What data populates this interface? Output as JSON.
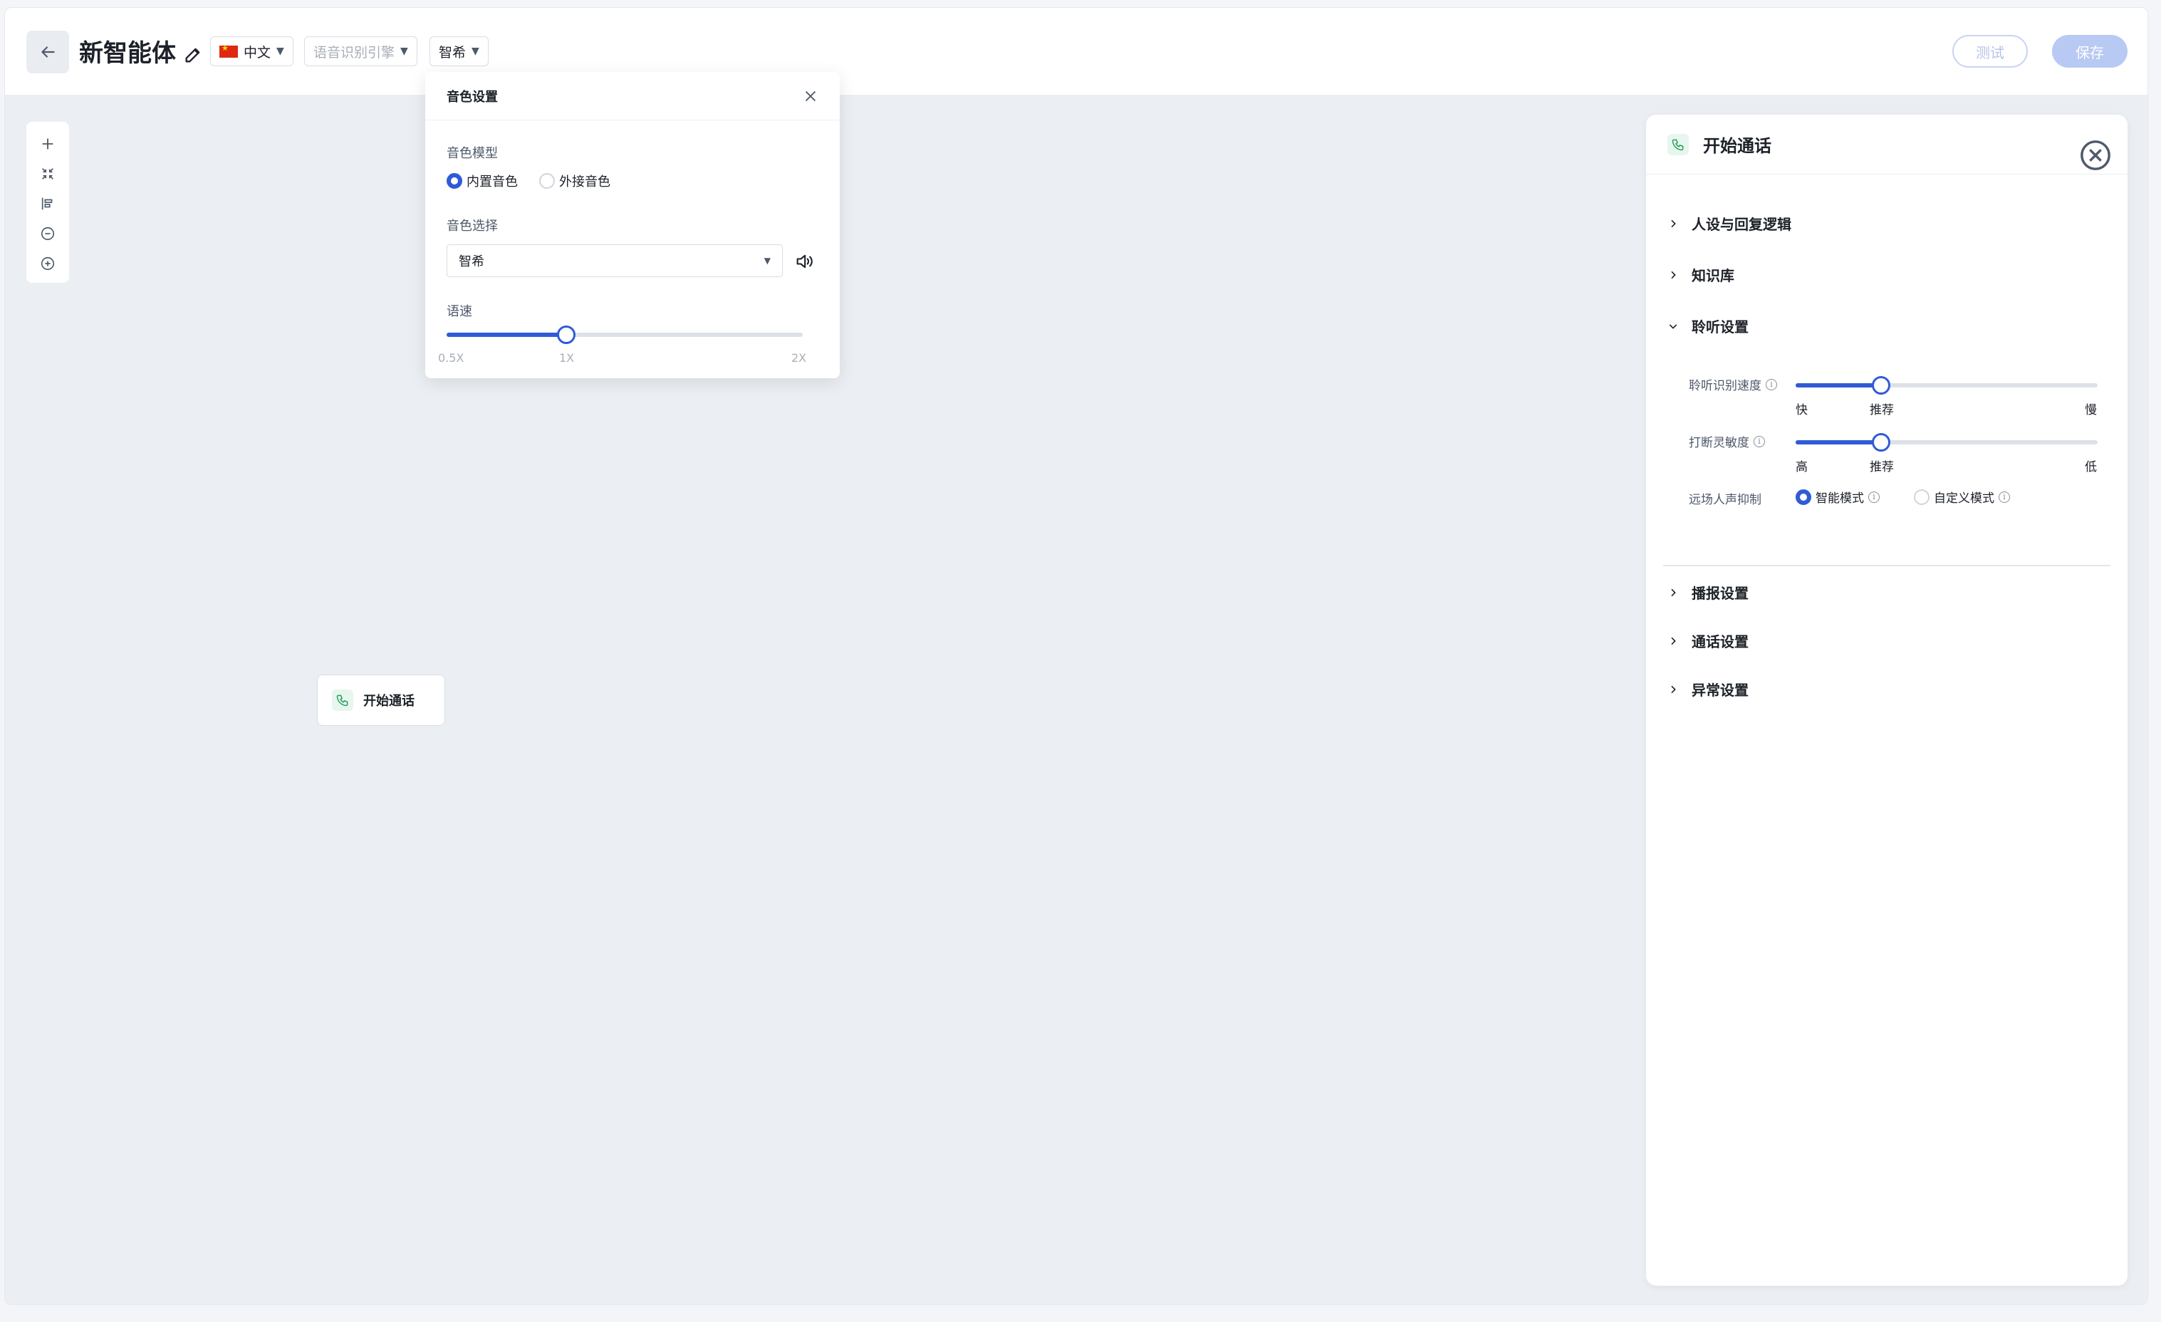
{
  "topbar": {
    "title": "新智能体",
    "language": "中文",
    "asr_placeholder": "语音识别引擎",
    "voice": "智希",
    "test_label": "测试",
    "save_label": "保存"
  },
  "voice_popup": {
    "title": "音色设置",
    "model_label": "音色模型",
    "model_options": [
      "内置音色",
      "外接音色"
    ],
    "model_selected": "内置音色",
    "voice_select_label": "音色选择",
    "voice_value": "智希",
    "speed_label": "语速",
    "speed_ticks": [
      "0.5X",
      "1X",
      "2X"
    ],
    "speed_value": "1X"
  },
  "node": {
    "label": "开始通话"
  },
  "panel": {
    "title": "开始通话",
    "sections": [
      "人设与回复逻辑",
      "知识库",
      "聆听设置",
      "播报设置",
      "通话设置",
      "异常设置"
    ],
    "expanded_section": "聆听设置",
    "listen": {
      "speed_label": "聆听识别速度",
      "speed_ticks": [
        "快",
        "推荐",
        "慢"
      ],
      "speed_value": "推荐",
      "interrupt_label": "打断灵敏度",
      "interrupt_ticks": [
        "高",
        "推荐",
        "低"
      ],
      "interrupt_value": "推荐",
      "suppress_label": "远场人声抑制",
      "suppress_options": [
        "智能模式",
        "自定义模式"
      ],
      "suppress_selected": "智能模式"
    }
  },
  "colors": {
    "accent": "#2f5bd6",
    "canvas": "#ebeef3",
    "save_disabled": "#b8c9f3"
  }
}
